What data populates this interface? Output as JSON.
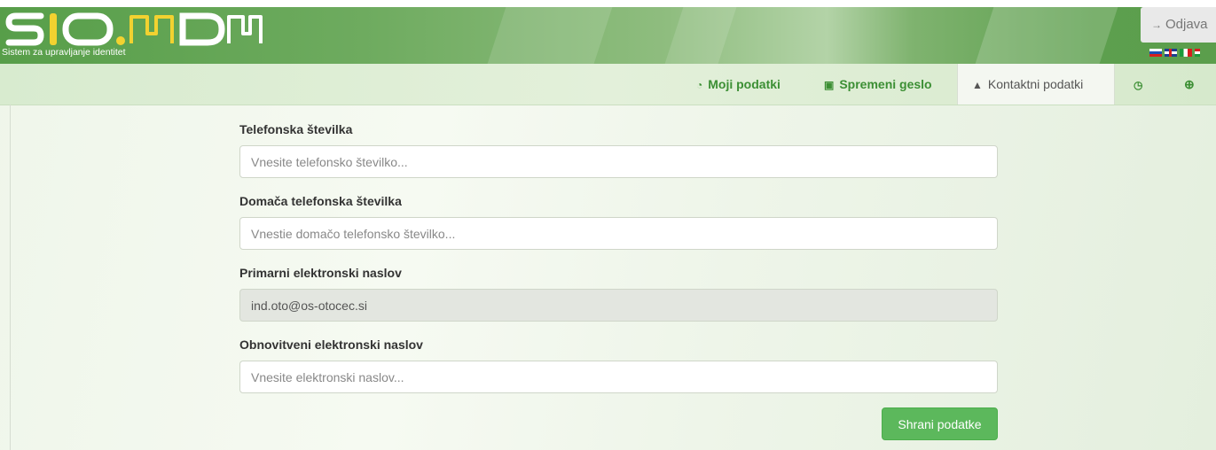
{
  "header": {
    "logo_text": "SIO.MDM",
    "subtitle": "Sistem za upravljanje identitet",
    "logout_label": "Odjava",
    "logout_icon": "sign-out-icon",
    "languages": [
      "sl",
      "en",
      "it",
      "hu"
    ]
  },
  "nav": {
    "items": [
      {
        "icon": "dashboard-icon",
        "label": "Moji podatki"
      },
      {
        "icon": "lock-icon",
        "label": "Spremeni geslo"
      },
      {
        "icon": "user-icon",
        "label": "Kontaktni podatki",
        "active": true
      },
      {
        "icon": "clock-icon",
        "label": ""
      },
      {
        "icon": "lifebuoy-icon",
        "label": ""
      }
    ]
  },
  "form": {
    "phone": {
      "label": "Telefonska številka",
      "placeholder": "Vnesite telefonsko številko...",
      "value": ""
    },
    "home_phone": {
      "label": "Domača telefonska številka",
      "placeholder": "Vnestie domačo telefonsko številko...",
      "value": ""
    },
    "primary_email": {
      "label": "Primarni elektronski naslov",
      "value": "ind.oto@os-otocec.si"
    },
    "recovery_email": {
      "label": "Obnovitveni elektronski naslov",
      "placeholder": "Vnesite elektronski naslov...",
      "value": ""
    },
    "save_label": "Shrani podatke"
  },
  "colors": {
    "brand_green": "#5cb85c",
    "nav_text": "#3c8f34",
    "header_green": "#6eab5f"
  }
}
